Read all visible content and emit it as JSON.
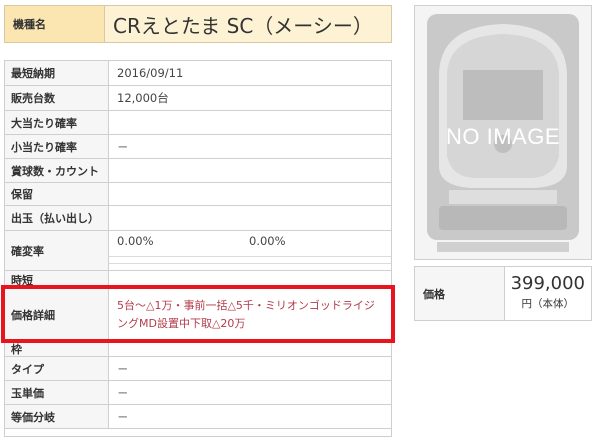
{
  "machine_name": {
    "label": "機種名",
    "value": "CRえとたま SC（メーシー）"
  },
  "spec_rows": [
    {
      "key": "最短納期",
      "value": "2016/09/11"
    },
    {
      "key": "販売台数",
      "value": "12,000台"
    },
    {
      "key": "大当たり確率",
      "value": ""
    },
    {
      "key": "小当たり確率",
      "value": "－"
    },
    {
      "key": "賞球数・カウント",
      "value": ""
    },
    {
      "key": "保留",
      "value": ""
    },
    {
      "key": "出玉（払い出し）",
      "value": ""
    },
    {
      "key": "確変率",
      "value": "0.00%",
      "value2": "0.00%"
    },
    {
      "key": "時短",
      "value": ""
    },
    {
      "key": "価格詳細",
      "value": "5台～△1万・事前一括△5千・ミリオンゴッドライジングMD設置中下取△20万"
    },
    {
      "key": "枠",
      "value": ""
    },
    {
      "key": "タイプ",
      "value": "－"
    },
    {
      "key": "玉単価",
      "value": "－"
    },
    {
      "key": "等価分岐",
      "value": "－"
    }
  ],
  "image": {
    "placeholder_text": "NO IMAGE",
    "icon": "pachinko-machine-icon"
  },
  "price": {
    "label": "価格",
    "value": "399,000",
    "unit": "円（本体）"
  }
}
